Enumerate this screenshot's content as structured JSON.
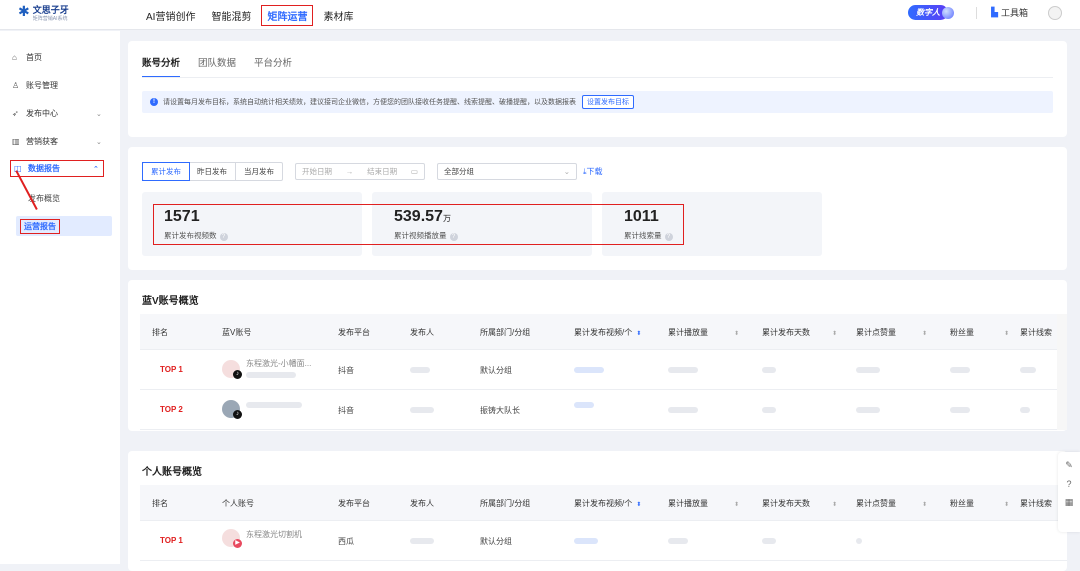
{
  "app": {
    "logo_name": "文思子牙",
    "logo_sub": "矩阵营销AI系统"
  },
  "topnav": [
    "AI营销创作",
    "智能混剪",
    "矩阵运营",
    "素材库"
  ],
  "topnav_active": "矩阵运营",
  "header_right": {
    "digital_human": "数字人",
    "toolbox": "工具箱"
  },
  "sidebar": {
    "home": "首页",
    "accounts": "账号管理",
    "publish": "发布中心",
    "marketing": "营销获客",
    "reports": "数据报告",
    "sub_overview": "发布概览",
    "sub_operation": "运营报告"
  },
  "tabs": [
    "账号分析",
    "团队数据",
    "平台分析"
  ],
  "notice": {
    "text": "请设置每月发布目标，系统自动统计相关绩效，建议接司企业微信，方便您的团队接收任务提醒、线索提醒、破播提醒，以及数据报表",
    "button": "设置发布目标"
  },
  "filters": {
    "segments": [
      "累计发布",
      "昨日发布",
      "当月发布"
    ],
    "start_date": "开始日期",
    "arrow": "→",
    "end_date": "结束日期",
    "group": "全部分组",
    "download": "下载"
  },
  "stats": [
    {
      "value": "1571",
      "unit": "",
      "label": "累计发布视频数"
    },
    {
      "value": "539.57",
      "unit": "万",
      "label": "累计视频播放量"
    },
    {
      "value": "1011",
      "unit": "",
      "label": "累计线索量"
    }
  ],
  "blue_v": {
    "title": "蓝V账号概览",
    "columns": [
      "排名",
      "蓝V账号",
      "发布平台",
      "发布人",
      "所属部门/分组",
      "累计发布视频/个",
      "累计播放量",
      "累计发布天数",
      "累计点赞量",
      "粉丝量",
      "累计线索"
    ],
    "rows": [
      {
        "rank": "TOP 1",
        "account": "东程激光-小幡面...",
        "platform": "抖音",
        "group": "默认分组"
      },
      {
        "rank": "TOP 2",
        "account": "",
        "platform": "抖音",
        "group": "振铸大队长"
      }
    ]
  },
  "personal": {
    "title": "个人账号概览",
    "columns": [
      "排名",
      "个人账号",
      "发布平台",
      "发布人",
      "所属部门/分组",
      "累计发布视频/个",
      "累计播放量",
      "累计发布天数",
      "累计点赞量",
      "粉丝量",
      "累计线索"
    ],
    "rows": [
      {
        "rank": "TOP 1",
        "account": "东程激光切割机",
        "platform": "西瓜",
        "group": "默认分组"
      }
    ]
  },
  "colors": {
    "accent": "#2f6bff",
    "highlight_red": "#e02020"
  }
}
